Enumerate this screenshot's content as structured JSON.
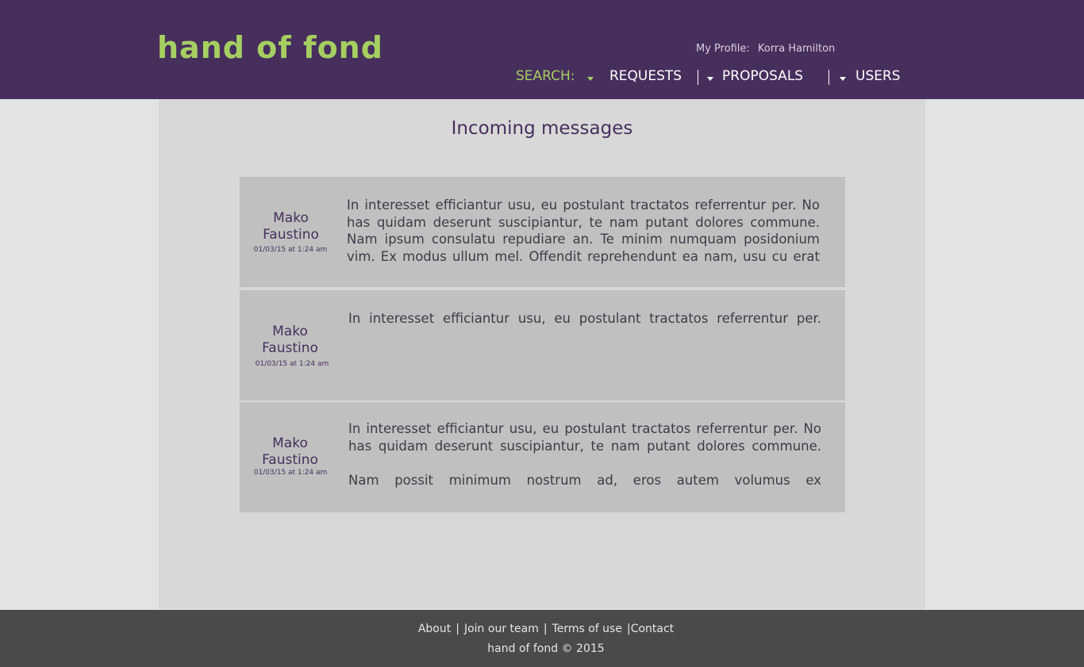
{
  "header": {
    "logo": "hand of fond",
    "profile_label": "My Profile:",
    "profile_name": "Korra Hamilton",
    "nav": {
      "search": "SEARCH:",
      "requests": "REQUESTS",
      "proposals": "PROPOSALS",
      "users": "USERS"
    }
  },
  "main": {
    "title": "Incoming messages",
    "messages": [
      {
        "sender": "Mako Faustino",
        "date": "01/03/15 at 1:24 am",
        "text": "In interesset efficiantur usu, eu postulant tractatos referrentur per. No has quidam deserunt suscipiantur, te nam putant dolores commune. Nam ipsum consulatu repudiare an. Te minim numquam posidonium vim. Ex modus ullum mel. Offendit reprehendunt ea nam, usu cu erat"
      },
      {
        "sender": "Mako Faustino",
        "date": "01/03/15 at 1:24 am",
        "text": "In interesset efficiantur usu, eu postulant tractatos referrentur per."
      },
      {
        "sender": "Mako Faustino",
        "date": "01/03/15 at 1:24 am",
        "text": "In interesset efficiantur usu, eu postulant tractatos referrentur per. No has quidam deserunt suscipiantur, te nam putant dolores commune.",
        "text2": "Nam possit minimum nostrum ad, eros autem volumus ex"
      }
    ]
  },
  "footer": {
    "about": "About",
    "join": "Join our team",
    "terms": "Terms of use",
    "contact": "Contact",
    "copyright": "hand of fond © 2015"
  },
  "colors": {
    "header_bg": "#472f5d",
    "accent": "#a6cf61",
    "footer_bg": "#4a4a4a"
  }
}
